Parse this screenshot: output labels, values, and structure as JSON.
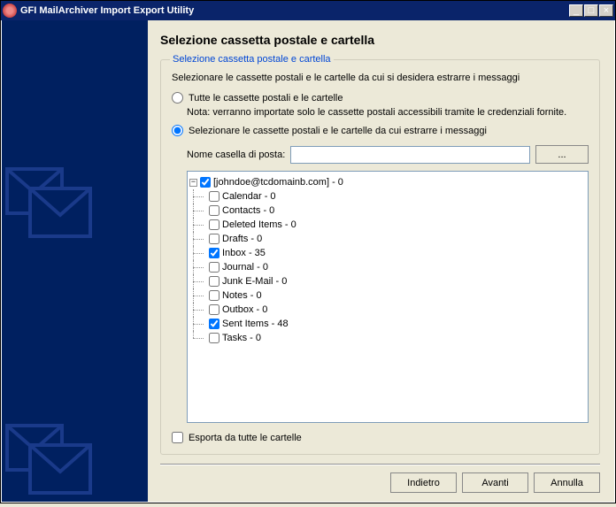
{
  "window": {
    "title": "GFI MailArchiver Import Export Utility"
  },
  "page": {
    "title": "Selezione cassetta postale e cartella",
    "group_legend": "Selezione cassetta postale e cartella",
    "description": "Selezionare le cassette postali e le cartelle da cui si desidera estrarre i messaggi",
    "radio_all_label": "Tutte le cassette postali e le cartelle",
    "note": "Nota: verranno importate solo le cassette postali accessibili tramite le credenziali fornite.",
    "radio_select_label": "Selezionare le cassette postali e le cartelle da cui estrarre i messaggi",
    "mailbox_name_label": "Nome casella di posta:",
    "mailbox_name_value": "",
    "browse_label": "...",
    "export_all_label": "Esporta da tutte le cartelle"
  },
  "selection": {
    "radio_all_checked": false,
    "radio_select_checked": true,
    "export_all_checked": false
  },
  "tree": {
    "root": {
      "label": "[johndoe@tcdomainb.com] - 0",
      "checked": true,
      "expanded": true,
      "children": [
        {
          "label": "Calendar - 0",
          "checked": false
        },
        {
          "label": "Contacts - 0",
          "checked": false
        },
        {
          "label": "Deleted Items - 0",
          "checked": false
        },
        {
          "label": "Drafts - 0",
          "checked": false
        },
        {
          "label": "Inbox - 35",
          "checked": true
        },
        {
          "label": "Journal - 0",
          "checked": false
        },
        {
          "label": "Junk E-Mail - 0",
          "checked": false
        },
        {
          "label": "Notes - 0",
          "checked": false
        },
        {
          "label": "Outbox - 0",
          "checked": false
        },
        {
          "label": "Sent Items - 48",
          "checked": true
        },
        {
          "label": "Tasks - 0",
          "checked": false
        }
      ]
    }
  },
  "footer": {
    "back": "Indietro",
    "next": "Avanti",
    "cancel": "Annulla"
  }
}
